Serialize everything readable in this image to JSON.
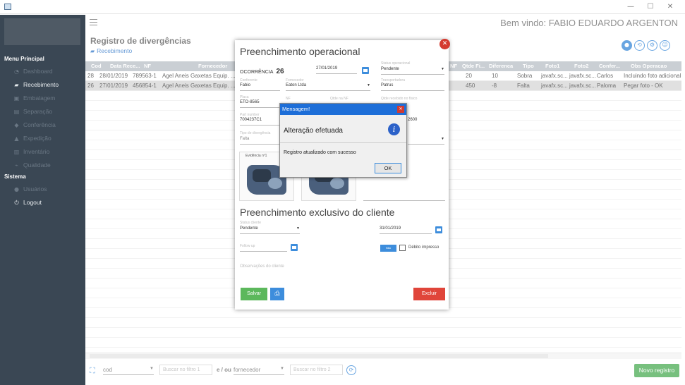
{
  "window": {
    "minimize": "—",
    "maximize": "☐",
    "close": "✕"
  },
  "sidebar": {
    "section_main": "Menu Principal",
    "section_system": "Sistema",
    "items": [
      {
        "label": "Dashboard",
        "icon": "dashboard-icon",
        "glyph": "◔"
      },
      {
        "label": "Recebimento",
        "icon": "truck-icon",
        "glyph": "▰"
      },
      {
        "label": "Embalagem",
        "icon": "box-icon",
        "glyph": "▣"
      },
      {
        "label": "Separação",
        "icon": "pallet-icon",
        "glyph": "▤"
      },
      {
        "label": "Conferência",
        "icon": "check-icon",
        "glyph": "◆"
      },
      {
        "label": "Expedição",
        "icon": "forklift-icon",
        "glyph": "▲"
      },
      {
        "label": "Inventário",
        "icon": "bar-chart-icon",
        "glyph": "▥"
      },
      {
        "label": "Qualidade",
        "icon": "line-chart-icon",
        "glyph": "⌁"
      }
    ],
    "system_items": [
      {
        "label": "Usuários",
        "icon": "user-icon",
        "glyph": "●"
      },
      {
        "label": "Logout",
        "icon": "power-icon",
        "glyph": "⏻"
      }
    ]
  },
  "header": {
    "welcome": "Bem vindo: FABIO EDUARDO ARGENTON"
  },
  "page": {
    "title": "Registro de divergências",
    "subtitle": "Recebimento"
  },
  "table": {
    "left_headers": [
      "Cod",
      "Data Rece...",
      "NF",
      "Fornecedor"
    ],
    "right_headers": [
      "NF",
      "Qtde Fi...",
      "Diferenca",
      "Tipo",
      "Foto1",
      "Foto2",
      "Confer...",
      "Obs Operacao"
    ],
    "rows": [
      {
        "left": [
          "28",
          "28/01/2019",
          "789563-1",
          "Agel Aneis Gaxetas Equip. ..."
        ],
        "right": [
          "20",
          "10",
          "Sobra",
          "javafx.sc...",
          "javafx.sc...",
          "Carlos",
          "Incluindo foto adicional"
        ]
      },
      {
        "left": [
          "26",
          "27/01/2019",
          "456854-1",
          "Agel Aneis Gaxetas Equip. ..."
        ],
        "right": [
          "450",
          "-8",
          "Falta",
          "javafx.sc...",
          "javafx.sc...",
          "Paloma",
          "Pegar foto - OK"
        ]
      }
    ]
  },
  "bottom": {
    "filter1": "cod",
    "filter1_ph": "Buscar no filtro 1",
    "conj": "e / ou",
    "filter2": "fornecedor",
    "filter2_ph": "Buscar no filtro 2",
    "new_button": "Novo registro"
  },
  "op_panel": {
    "title": "Preenchimento operacional",
    "ocorrencia_label": "OCORRÊNCIA",
    "ocorrencia_num": "26",
    "date": "27/01/2019",
    "status_label": "Status operacional",
    "status": "Pendente",
    "conferente_label": "Conferente",
    "conferente": "Fabio",
    "fornecedor_label": "Fornecedor",
    "fornecedor": "Eaton Ltda",
    "transportadora_label": "Transportadora",
    "transportadora": "Patrus",
    "placa_label": "Placa",
    "placa": "ETO-8565",
    "nf_label": "NF",
    "qtde_nf_label": "Qtde na NF",
    "qtde_fisico_label": "Qtde recebido no físico",
    "partnumber_label": "Part number",
    "partnumber": "7004237C1",
    "extra_value": "2600",
    "tipo_label": "Tipo de divergência",
    "tipo": "Falta",
    "evidencia": "Evidência nº1",
    "client_title": "Preenchimento exclusivo do cliente",
    "status_cliente_label": "Status cliente",
    "status_cliente": "Pendente",
    "date2": "31/01/2019",
    "followup_label": "Follow up",
    "toggle": "Não",
    "debito": "Débito impresso",
    "obs_label": "Observações do cliente",
    "save": "Salvar",
    "print_glyph": "⎙",
    "delete": "Excluir"
  },
  "dialog": {
    "title": "Mensagem!",
    "header": "Alteração efetuada",
    "message": "Registro atualizado com sucesso",
    "ok": "OK",
    "info_glyph": "i"
  },
  "colors": {
    "sidebar": "#3a4754",
    "accent": "#1976d2",
    "save": "#5cb85c",
    "delete": "#e0453a",
    "new": "#2e9e3a"
  }
}
